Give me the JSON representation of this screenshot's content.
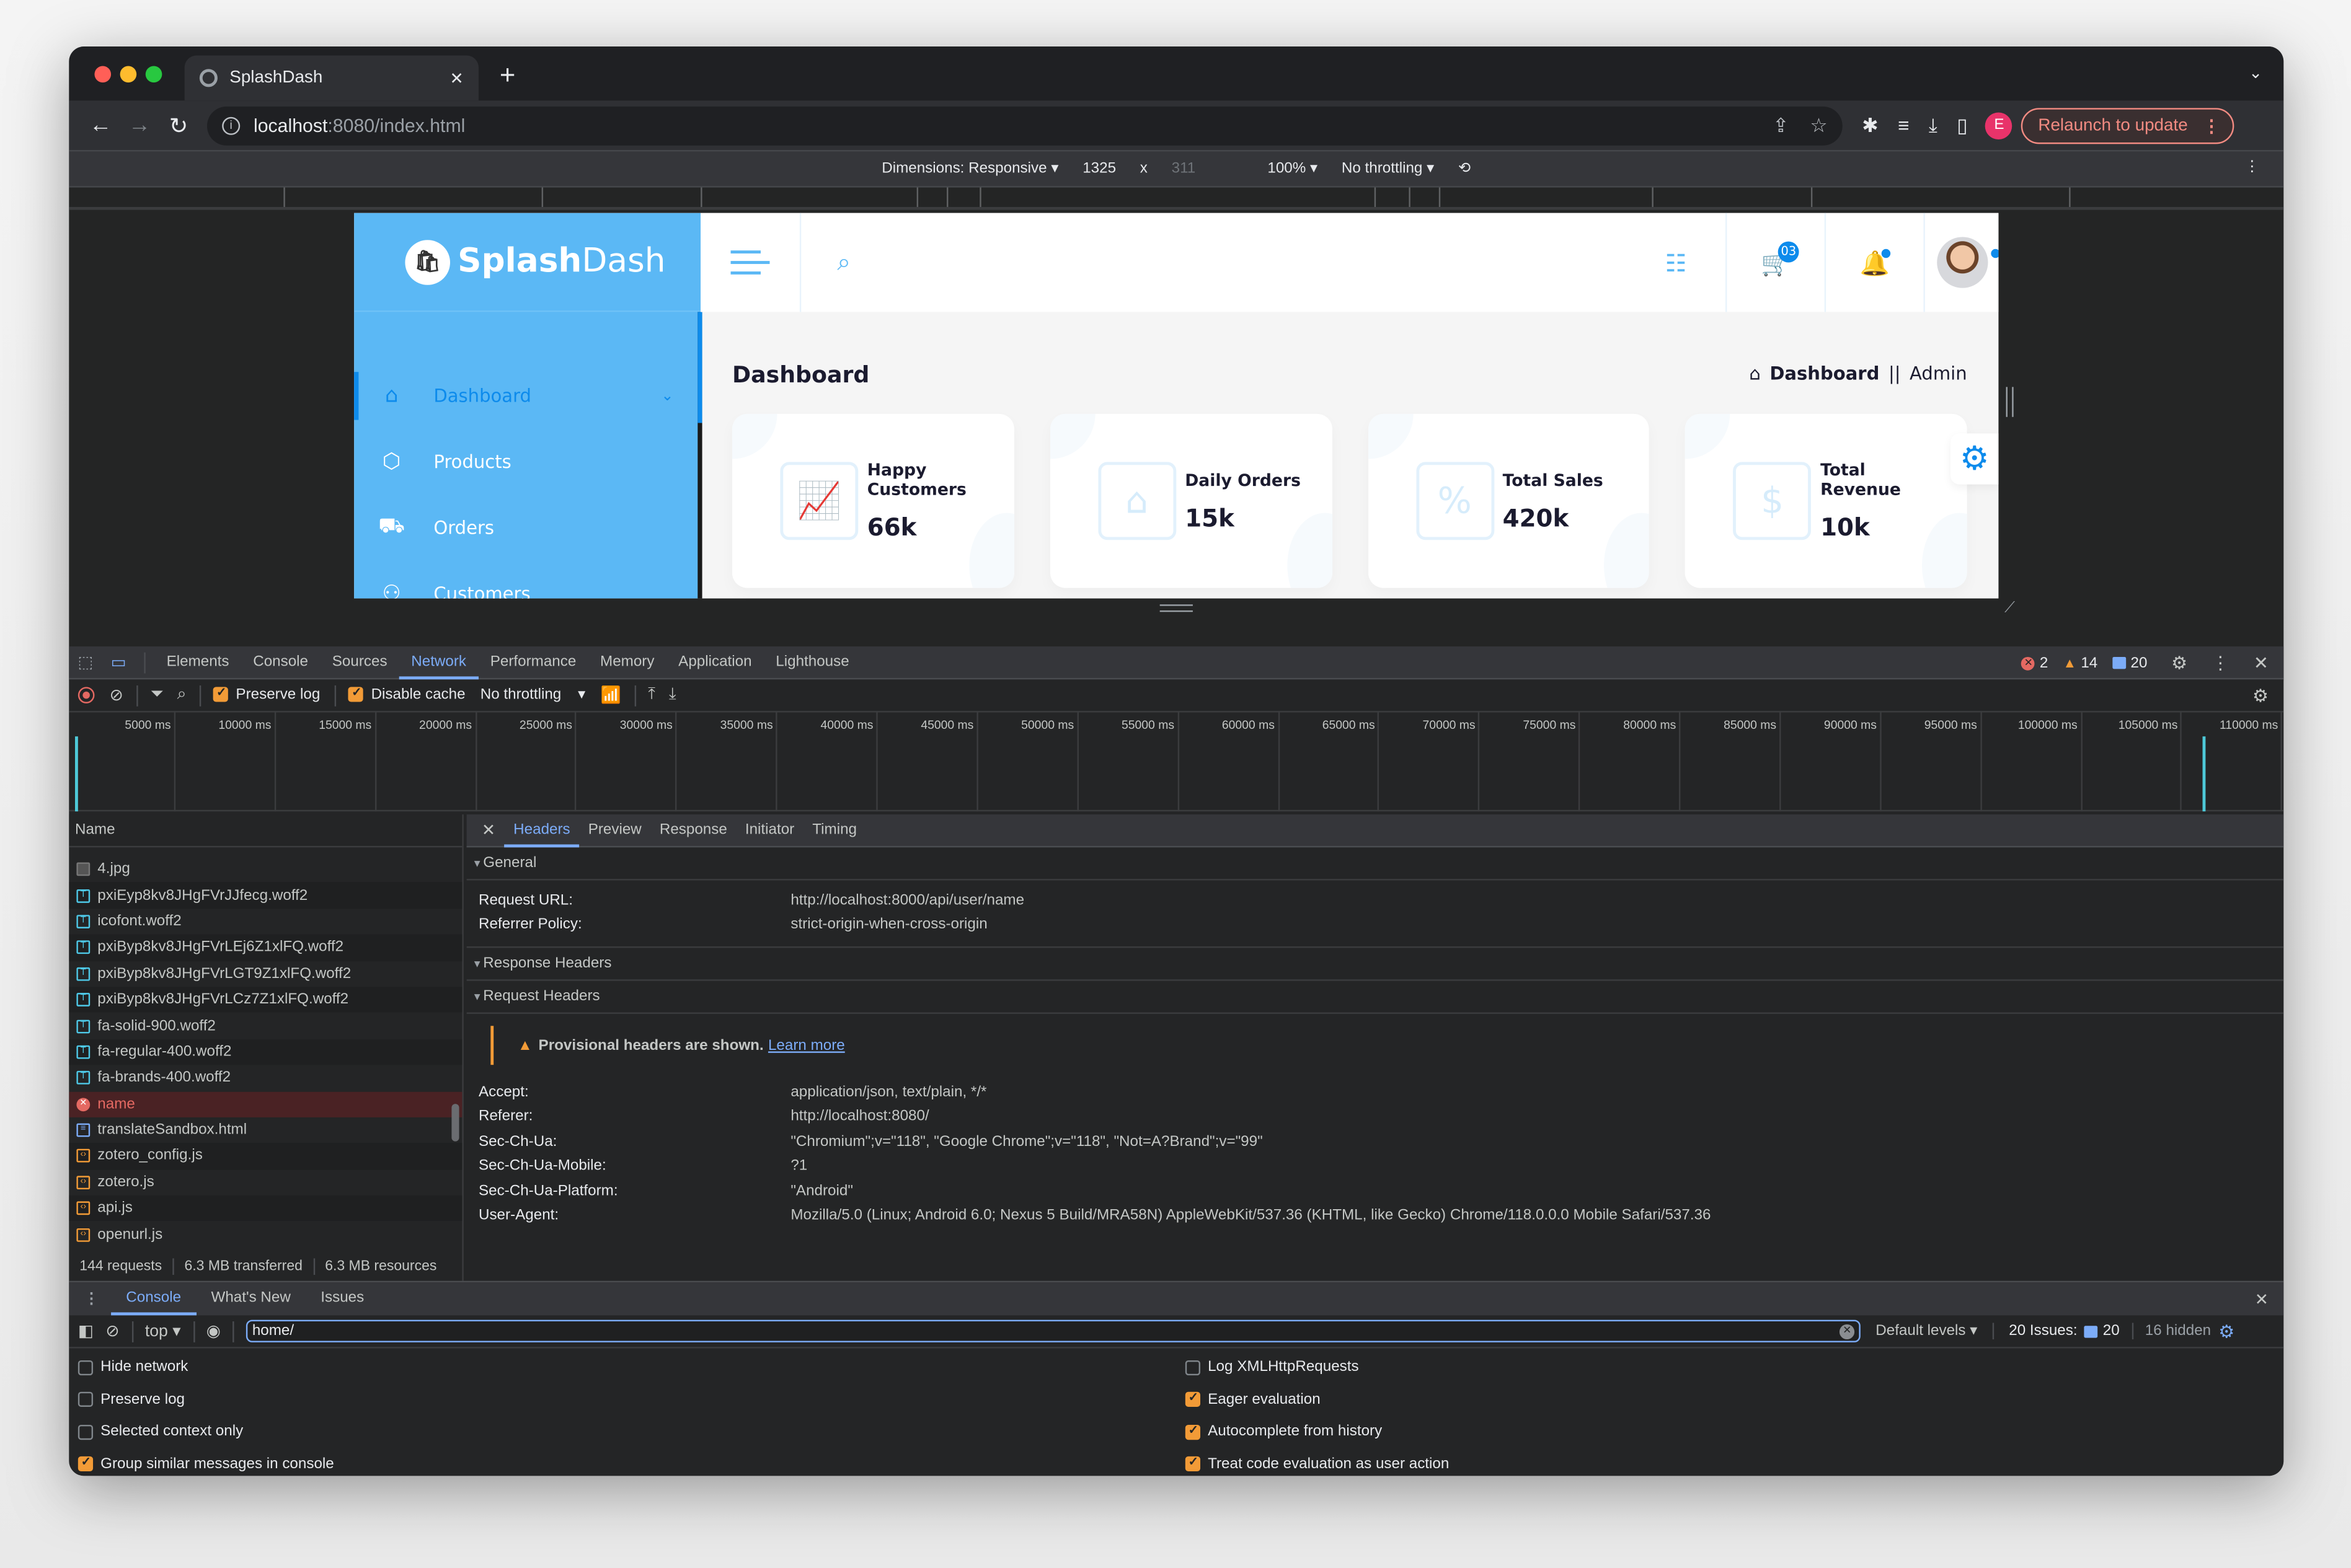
{
  "browser": {
    "tab": {
      "title": "SplashDash",
      "favicon": "globe-icon"
    },
    "url": {
      "host": "localhost",
      "path": ":8080/index.html"
    },
    "relaunch_label": "Relaunch to update",
    "profile_initial": "E"
  },
  "device_toolbar": {
    "dimensions": "Dimensions: Responsive",
    "width": "1325",
    "times": "x",
    "height": "311",
    "zoom": "100%",
    "throttling": "No throttling"
  },
  "app": {
    "brand": {
      "first": "Splash",
      "second": "Dash"
    },
    "sidebar": [
      {
        "label": "Dashboard",
        "icon": "home-icon",
        "active": true
      },
      {
        "label": "Products",
        "icon": "box-icon"
      },
      {
        "label": "Orders",
        "icon": "truck-icon"
      },
      {
        "label": "Customers",
        "icon": "users-icon"
      }
    ],
    "header": {
      "cart_badge": "03"
    },
    "page_title": "Dashboard",
    "breadcrumb": {
      "current": "Dashboard",
      "separator": "||",
      "role": "Admin"
    },
    "cards": [
      {
        "label": "Happy Customers",
        "value": "66k",
        "icon": "growth-chart-icon"
      },
      {
        "label": "Daily Orders",
        "value": "15k",
        "icon": "house-order-icon"
      },
      {
        "label": "Total Sales",
        "value": "420k",
        "icon": "laptop-sale-icon"
      },
      {
        "label": "Total Revenue",
        "value": "10k",
        "icon": "money-plant-icon"
      }
    ]
  },
  "devtools": {
    "tabs": [
      "Elements",
      "Console",
      "Sources",
      "Network",
      "Performance",
      "Memory",
      "Application",
      "Lighthouse"
    ],
    "active_tab": "Network",
    "counts": {
      "errors": "2",
      "warnings": "14",
      "messages": "20"
    },
    "network_toolbar": {
      "preserve_log": {
        "label": "Preserve log",
        "checked": true
      },
      "disable_cache": {
        "label": "Disable cache",
        "checked": true
      },
      "throttling": "No throttling"
    },
    "timeline_ticks": [
      "5000 ms",
      "10000 ms",
      "15000 ms",
      "20000 ms",
      "25000 ms",
      "30000 ms",
      "35000 ms",
      "40000 ms",
      "45000 ms",
      "50000 ms",
      "55000 ms",
      "60000 ms",
      "65000 ms",
      "70000 ms",
      "75000 ms",
      "80000 ms",
      "85000 ms",
      "90000 ms",
      "95000 ms",
      "100000 ms",
      "105000 ms",
      "110000 ms"
    ],
    "name_header": "Name",
    "files": [
      {
        "name": "4.jpg",
        "type": "img"
      },
      {
        "name": "pxiEyp8kv8JHgFVrJJfecg.woff2",
        "type": "font"
      },
      {
        "name": "icofont.woff2",
        "type": "font"
      },
      {
        "name": "pxiByp8kv8JHgFVrLEj6Z1xlFQ.woff2",
        "type": "font"
      },
      {
        "name": "pxiByp8kv8JHgFVrLGT9Z1xlFQ.woff2",
        "type": "font"
      },
      {
        "name": "pxiByp8kv8JHgFVrLCz7Z1xlFQ.woff2",
        "type": "font"
      },
      {
        "name": "fa-solid-900.woff2",
        "type": "font"
      },
      {
        "name": "fa-regular-400.woff2",
        "type": "font"
      },
      {
        "name": "fa-brands-400.woff2",
        "type": "font"
      },
      {
        "name": "name",
        "type": "error",
        "selected": true
      },
      {
        "name": "translateSandbox.html",
        "type": "doc"
      },
      {
        "name": "zotero_config.js",
        "type": "script"
      },
      {
        "name": "zotero.js",
        "type": "script"
      },
      {
        "name": "api.js",
        "type": "script"
      },
      {
        "name": "openurl.js",
        "type": "script"
      }
    ],
    "summary": {
      "requests": "144 requests",
      "transferred": "6.3 MB transferred",
      "resources": "6.3 MB resources"
    },
    "detail_tabs": [
      "Headers",
      "Preview",
      "Response",
      "Initiator",
      "Timing"
    ],
    "detail_active": "Headers",
    "general": {
      "title": "General",
      "rows": [
        {
          "k": "Request URL:",
          "v": "http://localhost:8000/api/user/name"
        },
        {
          "k": "Referrer Policy:",
          "v": "strict-origin-when-cross-origin"
        }
      ]
    },
    "response_headers_title": "Response Headers",
    "request_headers": {
      "title": "Request Headers",
      "warning": "Provisional headers are shown.",
      "learn_more": "Learn more",
      "rows": [
        {
          "k": "Accept:",
          "v": "application/json, text/plain, */*"
        },
        {
          "k": "Referer:",
          "v": "http://localhost:8080/"
        },
        {
          "k": "Sec-Ch-Ua:",
          "v": "\"Chromium\";v=\"118\", \"Google Chrome\";v=\"118\", \"Not=A?Brand\";v=\"99\""
        },
        {
          "k": "Sec-Ch-Ua-Mobile:",
          "v": "?1"
        },
        {
          "k": "Sec-Ch-Ua-Platform:",
          "v": "\"Android\""
        },
        {
          "k": "User-Agent:",
          "v": "Mozilla/5.0 (Linux; Android 6.0; Nexus 5 Build/MRA58N) AppleWebKit/537.36 (KHTML, like Gecko) Chrome/118.0.0.0 Mobile Safari/537.36"
        }
      ]
    },
    "drawer": {
      "tabs": [
        "Console",
        "What's New",
        "Issues"
      ],
      "active": "Console",
      "context": "top",
      "filter_value": "home/",
      "levels": "Default levels",
      "issues_label": "20 Issues:",
      "issues_count": "20",
      "hidden": "16 hidden",
      "settings_left": [
        {
          "label": "Hide network",
          "checked": false
        },
        {
          "label": "Preserve log",
          "checked": false
        },
        {
          "label": "Selected context only",
          "checked": false
        },
        {
          "label": "Group similar messages in console",
          "checked": true
        }
      ],
      "settings_right": [
        {
          "label": "Log XMLHttpRequests",
          "checked": false
        },
        {
          "label": "Eager evaluation",
          "checked": true
        },
        {
          "label": "Autocomplete from history",
          "checked": true
        },
        {
          "label": "Treat code evaluation as user action",
          "checked": true
        }
      ]
    }
  },
  "colors": {
    "brand": "#5bb8f5",
    "accent": "#0d8bec",
    "devtools_accent": "#7cacf8",
    "warning": "#f29b37",
    "error": "#e46962"
  }
}
